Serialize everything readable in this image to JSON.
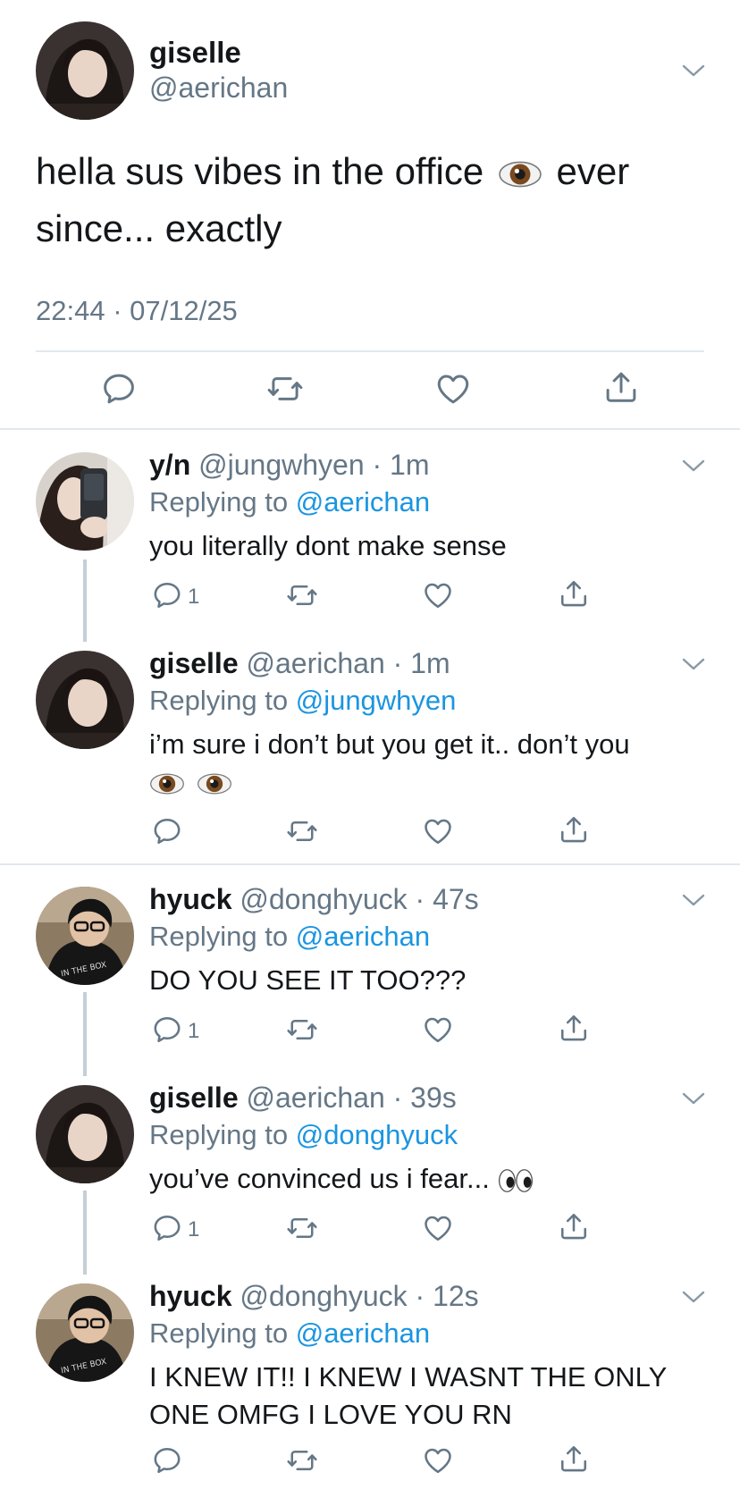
{
  "main_tweet": {
    "name": "giselle",
    "handle": "@aerichan",
    "text_part1": "hella sus vibes in the office",
    "text_part2": "ever",
    "text_line2": "since... exactly",
    "timestamp": "22:44 · 07/12/25"
  },
  "replies": [
    {
      "name": "y/n",
      "handle": "@jungwhyen",
      "time": "· 1m",
      "replying_prefix": "Replying to",
      "replying_to": "@aerichan",
      "text": "you literally dont make sense",
      "reply_count": "1"
    },
    {
      "name": "giselle",
      "handle": "@aerichan",
      "time": "· 1m",
      "replying_prefix": "Replying to",
      "replying_to": "@jungwhyen",
      "text": "i’m sure i don’t but you get it.. don’t you",
      "reply_count": ""
    },
    {
      "name": "hyuck",
      "handle": "@donghyuck",
      "time": "· 47s",
      "replying_prefix": "Replying to",
      "replying_to": "@aerichan",
      "text": "DO YOU SEE IT TOO???",
      "reply_count": "1"
    },
    {
      "name": "giselle",
      "handle": "@aerichan",
      "time": "· 39s",
      "replying_prefix": "Replying to",
      "replying_to": "@donghyuck",
      "text": "you’ve convinced us i fear...",
      "reply_count": "1"
    },
    {
      "name": "hyuck",
      "handle": "@donghyuck",
      "time": "· 12s",
      "replying_prefix": "Replying to",
      "replying_to": "@aerichan",
      "text_line1": "I KNEW IT!! I KNEW I WASNT THE ONLY",
      "text_line2": "ONE OMFG I LOVE YOU RN",
      "reply_count": ""
    }
  ],
  "colors": {
    "text": "#14171a",
    "secondary": "#657786",
    "link": "#1b95e0",
    "divider": "#e1e8ed",
    "thread_line": "#c4cfd6"
  },
  "icons": [
    "reply-icon",
    "retweet-icon",
    "like-icon",
    "share-icon",
    "chevron-down-icon",
    "eye-emoji",
    "eyes-emoji"
  ]
}
